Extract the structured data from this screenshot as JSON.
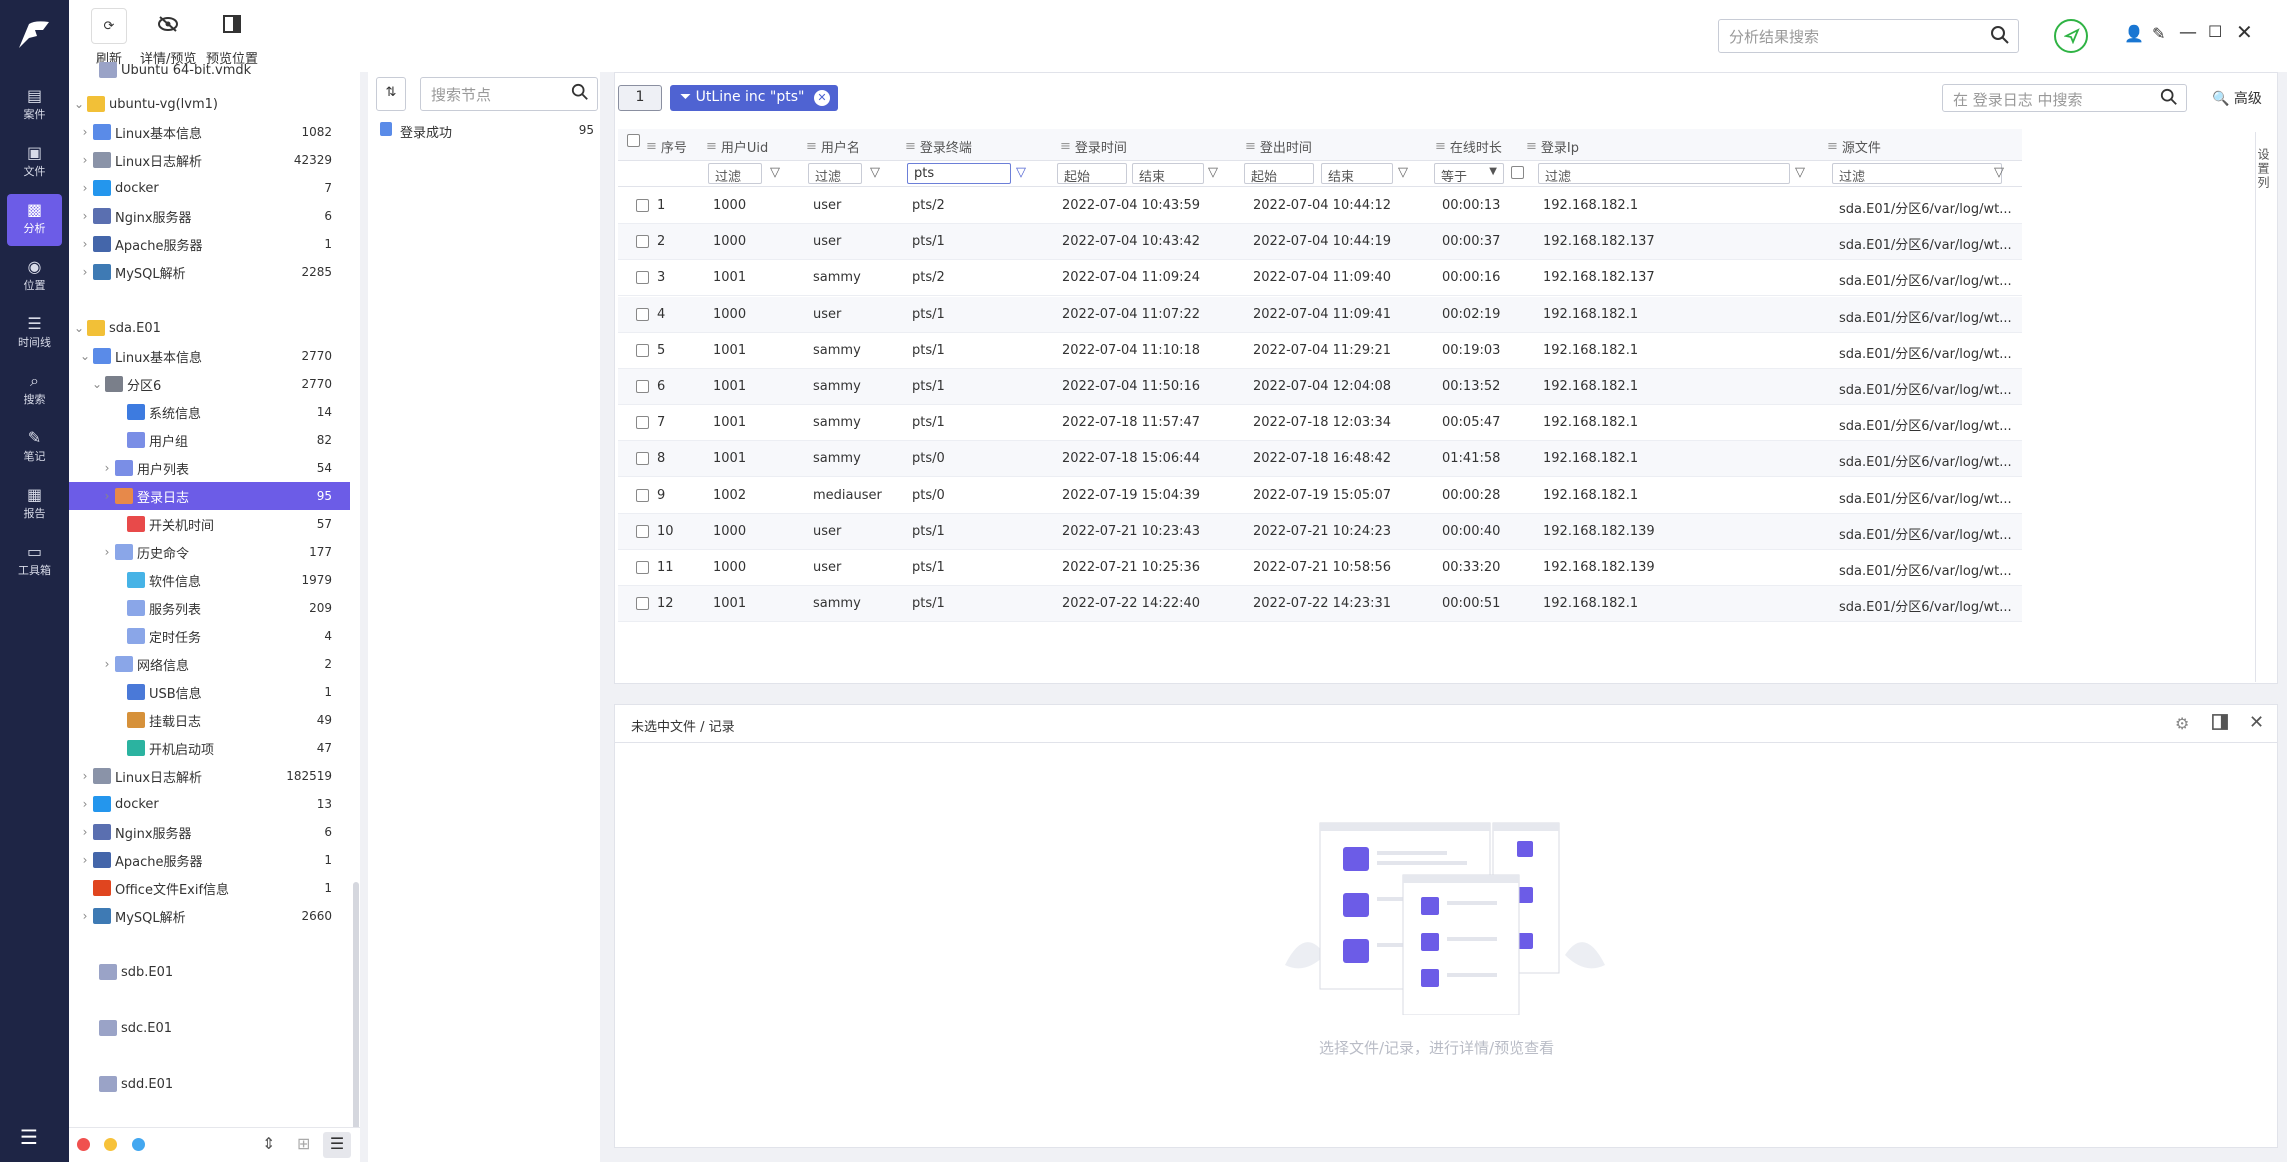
{
  "nav": {
    "items": [
      {
        "label": "案件",
        "icon": "case-icon"
      },
      {
        "label": "文件",
        "icon": "file-icon"
      },
      {
        "label": "分析",
        "icon": "analysis-icon"
      },
      {
        "label": "位置",
        "icon": "location-icon"
      },
      {
        "label": "时间线",
        "icon": "timeline-icon"
      },
      {
        "label": "搜索",
        "icon": "search-icon"
      },
      {
        "label": "笔记",
        "icon": "note-icon"
      },
      {
        "label": "报告",
        "icon": "report-icon"
      },
      {
        "label": "工具箱",
        "icon": "toolbox-icon"
      }
    ],
    "active": "分析"
  },
  "toolbar": {
    "refresh": "刷新",
    "details_preview": "详情/预览",
    "preview_position": "预览位置",
    "result_search_placeholder": "分析结果搜索"
  },
  "tree": {
    "rows": [
      {
        "label": "Ubuntu 64-bit.vmdk",
        "count": ""
      },
      {
        "label": "ubuntu-vg(lvm1)",
        "count": ""
      },
      {
        "label": "Linux基本信息",
        "count": "1082"
      },
      {
        "label": "Linux日志解析",
        "count": "42329"
      },
      {
        "label": "docker",
        "count": "7"
      },
      {
        "label": "Nginx服务器",
        "count": "6"
      },
      {
        "label": "Apache服务器",
        "count": "1"
      },
      {
        "label": "MySQL解析",
        "count": "2285"
      },
      {
        "label": "sda.E01",
        "count": ""
      },
      {
        "label": "Linux基本信息",
        "count": "2770"
      },
      {
        "label": "分区6",
        "count": "2770"
      },
      {
        "label": "系统信息",
        "count": "14"
      },
      {
        "label": "用户组",
        "count": "82"
      },
      {
        "label": "用户列表",
        "count": "54"
      },
      {
        "label": "登录日志",
        "count": "95"
      },
      {
        "label": "开关机时间",
        "count": "57"
      },
      {
        "label": "历史命令",
        "count": "177"
      },
      {
        "label": "软件信息",
        "count": "1979"
      },
      {
        "label": "服务列表",
        "count": "209"
      },
      {
        "label": "定时任务",
        "count": "4"
      },
      {
        "label": "网络信息",
        "count": "2"
      },
      {
        "label": "USB信息",
        "count": "1"
      },
      {
        "label": "挂载日志",
        "count": "49"
      },
      {
        "label": "开机启动项",
        "count": "47"
      },
      {
        "label": "Linux日志解析",
        "count": "182519"
      },
      {
        "label": "docker",
        "count": "13"
      },
      {
        "label": "Nginx服务器",
        "count": "6"
      },
      {
        "label": "Apache服务器",
        "count": "1"
      },
      {
        "label": "Office文件Exif信息",
        "count": "1"
      },
      {
        "label": "MySQL解析",
        "count": "2660"
      },
      {
        "label": "sdb.E01",
        "count": ""
      },
      {
        "label": "sdc.E01",
        "count": ""
      },
      {
        "label": "sdd.E01",
        "count": ""
      }
    ]
  },
  "nodes": {
    "search_placeholder": "搜索节点",
    "items": [
      {
        "label": "登录成功",
        "count": "95"
      }
    ]
  },
  "grid": {
    "page_badge": "1",
    "filter_chip": "UtLine inc \"pts\"",
    "search_placeholder": "在 登录日志 中搜索",
    "advanced": "高级",
    "side_settings": "设置列",
    "columns": [
      "序号",
      "用户Uid",
      "用户名",
      "登录终端",
      "登录时间",
      "登出时间",
      "在线时长",
      "登录Ip",
      "源文件"
    ],
    "filters": {
      "uid": "过滤",
      "name": "过滤",
      "terminal": "pts",
      "login_start": "起始",
      "login_end": "结束",
      "logout_start": "起始",
      "logout_end": "结束",
      "duration_op": "等于",
      "ip": "过滤",
      "source": "过滤"
    },
    "rows": [
      {
        "n": "1",
        "uid": "1000",
        "user": "user",
        "tty": "pts/2",
        "in": "2022-07-04 10:43:59",
        "out": "2022-07-04 10:44:12",
        "dur": "00:00:13",
        "ip": "192.168.182.1",
        "src": "sda.E01/分区6/var/log/wt..."
      },
      {
        "n": "2",
        "uid": "1000",
        "user": "user",
        "tty": "pts/1",
        "in": "2022-07-04 10:43:42",
        "out": "2022-07-04 10:44:19",
        "dur": "00:00:37",
        "ip": "192.168.182.137",
        "src": "sda.E01/分区6/var/log/wt..."
      },
      {
        "n": "3",
        "uid": "1001",
        "user": "sammy",
        "tty": "pts/2",
        "in": "2022-07-04 11:09:24",
        "out": "2022-07-04 11:09:40",
        "dur": "00:00:16",
        "ip": "192.168.182.137",
        "src": "sda.E01/分区6/var/log/wt..."
      },
      {
        "n": "4",
        "uid": "1000",
        "user": "user",
        "tty": "pts/1",
        "in": "2022-07-04 11:07:22",
        "out": "2022-07-04 11:09:41",
        "dur": "00:02:19",
        "ip": "192.168.182.1",
        "src": "sda.E01/分区6/var/log/wt..."
      },
      {
        "n": "5",
        "uid": "1001",
        "user": "sammy",
        "tty": "pts/1",
        "in": "2022-07-04 11:10:18",
        "out": "2022-07-04 11:29:21",
        "dur": "00:19:03",
        "ip": "192.168.182.1",
        "src": "sda.E01/分区6/var/log/wt..."
      },
      {
        "n": "6",
        "uid": "1001",
        "user": "sammy",
        "tty": "pts/1",
        "in": "2022-07-04 11:50:16",
        "out": "2022-07-04 12:04:08",
        "dur": "00:13:52",
        "ip": "192.168.182.1",
        "src": "sda.E01/分区6/var/log/wt..."
      },
      {
        "n": "7",
        "uid": "1001",
        "user": "sammy",
        "tty": "pts/1",
        "in": "2022-07-18 11:57:47",
        "out": "2022-07-18 12:03:34",
        "dur": "00:05:47",
        "ip": "192.168.182.1",
        "src": "sda.E01/分区6/var/log/wt..."
      },
      {
        "n": "8",
        "uid": "1001",
        "user": "sammy",
        "tty": "pts/0",
        "in": "2022-07-18 15:06:44",
        "out": "2022-07-18 16:48:42",
        "dur": "01:41:58",
        "ip": "192.168.182.1",
        "src": "sda.E01/分区6/var/log/wt..."
      },
      {
        "n": "9",
        "uid": "1002",
        "user": "mediauser",
        "tty": "pts/0",
        "in": "2022-07-19 15:04:39",
        "out": "2022-07-19 15:05:07",
        "dur": "00:00:28",
        "ip": "192.168.182.1",
        "src": "sda.E01/分区6/var/log/wt..."
      },
      {
        "n": "10",
        "uid": "1000",
        "user": "user",
        "tty": "pts/1",
        "in": "2022-07-21 10:23:43",
        "out": "2022-07-21 10:24:23",
        "dur": "00:00:40",
        "ip": "192.168.182.139",
        "src": "sda.E01/分区6/var/log/wt..."
      },
      {
        "n": "11",
        "uid": "1000",
        "user": "user",
        "tty": "pts/1",
        "in": "2022-07-21 10:25:36",
        "out": "2022-07-21 10:58:56",
        "dur": "00:33:20",
        "ip": "192.168.182.139",
        "src": "sda.E01/分区6/var/log/wt..."
      },
      {
        "n": "12",
        "uid": "1001",
        "user": "sammy",
        "tty": "pts/1",
        "in": "2022-07-22 14:22:40",
        "out": "2022-07-22 14:23:31",
        "dur": "00:00:51",
        "ip": "192.168.182.1",
        "src": "sda.E01/分区6/var/log/wt..."
      }
    ]
  },
  "detail": {
    "title": "未选中文件 / 记录",
    "empty_hint": "选择文件/记录，进行详情/预览查看"
  },
  "colors": {
    "nav_bg": "#1e2545",
    "accent": "#6c5ce7",
    "chip": "#4f63d2",
    "status_green": "#2fb344",
    "dot_red": "#f0514f",
    "dot_yellow": "#f7c23a",
    "dot_blue": "#43a7f0"
  }
}
